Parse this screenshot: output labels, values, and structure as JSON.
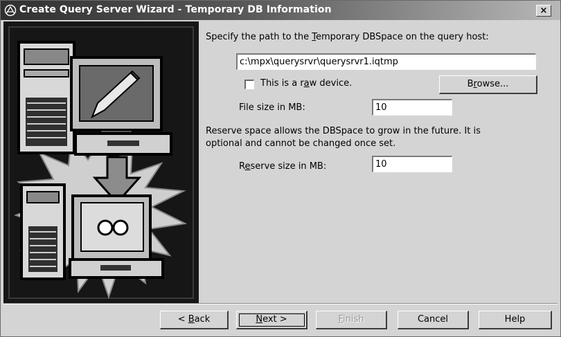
{
  "window": {
    "title": "Create Query Server Wizard - Temporary DB Information",
    "close_label": "×"
  },
  "form": {
    "path_prompt": {
      "pre": "Specify the path to the ",
      "key": "T",
      "post": "emporary DBSpace on the query host:"
    },
    "path_value": "c:\\mpx\\querysrvr\\querysrvr1.iqtmp",
    "raw_device": {
      "pre": "This is a r",
      "key": "a",
      "post": "w device.",
      "checked": false
    },
    "browse": {
      "pre": "B",
      "key": "r",
      "post": "owse..."
    },
    "file_size_label": "File size in MB:",
    "file_size_value": "10",
    "reserve_note_line1": "Reserve space allows the DBSpace to grow in the future.  It is",
    "reserve_note_line2": "optional and cannot be changed once set.",
    "reserve_size": {
      "pre": "R",
      "key": "e",
      "post": "serve size in MB:"
    },
    "reserve_size_value": "10"
  },
  "buttons": {
    "back": {
      "pre": "< ",
      "key": "B",
      "post": "ack"
    },
    "next": {
      "pre": "",
      "key": "N",
      "post": "ext >"
    },
    "finish": {
      "pre": "",
      "key": "F",
      "post": "inish",
      "enabled": false
    },
    "cancel": "Cancel",
    "help": "Help"
  },
  "icons": {
    "title": "wizard-app-icon",
    "illustration": "computer-transfer-illustration"
  }
}
